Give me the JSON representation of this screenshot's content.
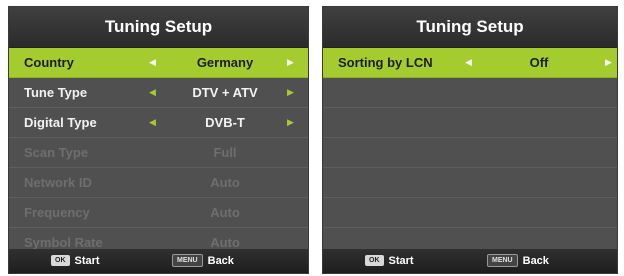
{
  "left_panel": {
    "title": "Tuning Setup",
    "rows": [
      {
        "label": "Country",
        "value": "Germany"
      },
      {
        "label": "Tune Type",
        "value": "DTV + ATV"
      },
      {
        "label": "Digital Type",
        "value": "DVB-T"
      },
      {
        "label": "Scan Type",
        "value": "Full"
      },
      {
        "label": "Network ID",
        "value": "Auto"
      },
      {
        "label": "Frequency",
        "value": "Auto"
      },
      {
        "label": "Symbol Rate",
        "value": "Auto"
      }
    ],
    "footer": {
      "ok_key": "OK",
      "ok_label": "Start",
      "menu_key": "MENU",
      "menu_label": "Back"
    }
  },
  "right_panel": {
    "title": "Tuning Setup",
    "rows": [
      {
        "label": "Sorting by LCN",
        "value": "Off"
      }
    ],
    "footer": {
      "ok_key": "OK",
      "ok_label": "Start",
      "menu_key": "MENU",
      "menu_label": "Back"
    }
  },
  "colors": {
    "highlight": "#a4cc2e",
    "panel_bg": "#505050",
    "disabled_text": "#6e6e6e"
  },
  "icons": {
    "arrow_left": "arrow-left-icon",
    "arrow_right": "arrow-right-icon"
  }
}
